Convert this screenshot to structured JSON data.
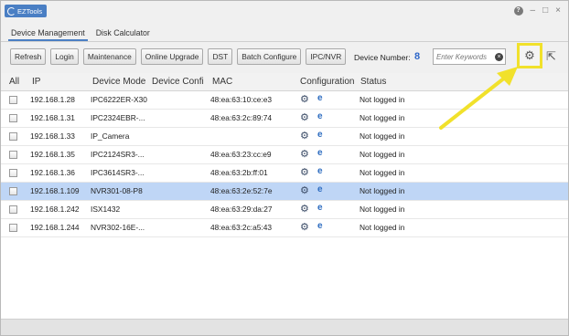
{
  "app": {
    "title": "EZTools",
    "help_icon": "help-icon",
    "minimize": "–",
    "maximize": "□",
    "close": "×"
  },
  "tabs": [
    {
      "label": "Device Management"
    },
    {
      "label": "Disk Calculator"
    }
  ],
  "toolbar": {
    "refresh": "Refresh",
    "login": "Login",
    "maintenance": "Maintenance",
    "online_upgrade": "Online Upgrade",
    "dst": "DST",
    "batch_configure": "Batch Configure",
    "ipc_nvr": "IPC/NVR",
    "device_number_label": "Device Number:",
    "device_number_value": "8",
    "search_placeholder": "Enter Keywords",
    "settings_icon": "gear-icon",
    "export_icon": "export-icon"
  },
  "columns": [
    "All",
    "IP",
    "Device Mode",
    "Device Confi",
    "MAC",
    "Configuration",
    "Status"
  ],
  "rows": [
    {
      "ip": "192.168.1.28",
      "model": "IPC6222ER-X30",
      "mac": "48:ea:63:10:ce:e3",
      "status": "Not logged in"
    },
    {
      "ip": "192.168.1.31",
      "model": "IPC2324EBR-...",
      "mac": "48:ea:63:2c:89:74",
      "status": "Not logged in"
    },
    {
      "ip": "192.168.1.33",
      "model": "IP_Camera",
      "mac": "",
      "status": "Not logged in"
    },
    {
      "ip": "192.168.1.35",
      "model": "IPC2124SR3-...",
      "mac": "48:ea:63:23:cc:e9",
      "status": "Not logged in"
    },
    {
      "ip": "192.168.1.36",
      "model": "IPC3614SR3-...",
      "mac": "48:ea:63:2b:ff:01",
      "status": "Not logged in"
    },
    {
      "ip": "192.168.1.109",
      "model": "NVR301-08-P8",
      "mac": "48:ea:63:2e:52:7e",
      "status": "Not logged in"
    },
    {
      "ip": "192.168.1.242",
      "model": "ISX1432",
      "mac": "48:ea:63:29:da:27",
      "status": "Not logged in"
    },
    {
      "ip": "192.168.1.244",
      "model": "NVR302-16E-...",
      "mac": "48:ea:63:2c:a5:43",
      "status": "Not logged in"
    }
  ],
  "colors": {
    "accent": "#4a7fc4",
    "highlight": "#f1e12b",
    "selected_row": "#bfd6f6"
  }
}
